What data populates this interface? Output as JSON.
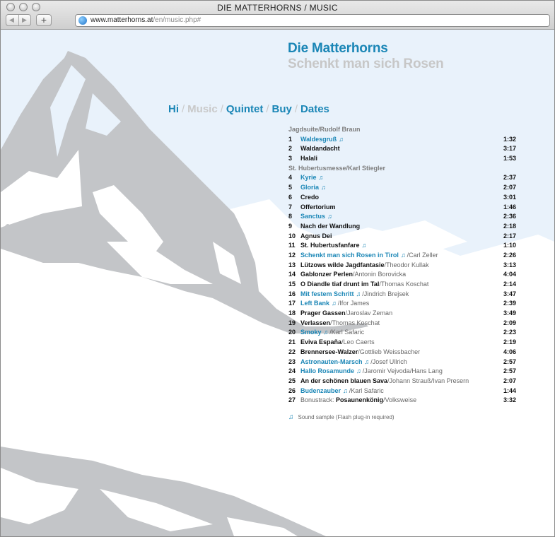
{
  "window": {
    "title": "DIE MATTERHORNS / MUSIC"
  },
  "browser": {
    "url_host": "www.matterhorns.at",
    "url_path": "/en/music.php#",
    "back_glyph": "◀",
    "forward_glyph": "▶",
    "new_tab_glyph": "+"
  },
  "header": {
    "title": "Die Matterhorns",
    "subtitle": "Schenkt man sich Rosen"
  },
  "nav": {
    "items": [
      {
        "label": "Hi"
      },
      {
        "label": "Music"
      },
      {
        "label": "Quintet"
      },
      {
        "label": "Buy"
      },
      {
        "label": "Dates"
      }
    ],
    "separator": "/"
  },
  "tracklist": {
    "note_glyph": "♫",
    "groups": [
      {
        "label": "Jagdsuite/Rudolf Braun"
      },
      {
        "label": "St. Hubertusmesse/Karl Stiegler"
      }
    ],
    "tracks": [
      {
        "n": "1",
        "title": "Waldesgruß",
        "composer": "",
        "duration": "1:32"
      },
      {
        "n": "2",
        "title": "Waldandacht",
        "composer": "",
        "duration": "3:17"
      },
      {
        "n": "3",
        "title": "Halali",
        "composer": "",
        "duration": "1:53"
      },
      {
        "n": "4",
        "title": "Kyrie",
        "composer": "",
        "duration": "2:37"
      },
      {
        "n": "5",
        "title": "Gloria",
        "composer": "",
        "duration": "2:07"
      },
      {
        "n": "6",
        "title": "Credo",
        "composer": "",
        "duration": "3:01"
      },
      {
        "n": "7",
        "title": "Offertorium",
        "composer": "",
        "duration": "1:46"
      },
      {
        "n": "8",
        "title": "Sanctus",
        "composer": "",
        "duration": "2:36"
      },
      {
        "n": "9",
        "title": "Nach der Wandlung",
        "composer": "",
        "duration": "2:18"
      },
      {
        "n": "10",
        "title": "Agnus Dei",
        "composer": "",
        "duration": "2:17"
      },
      {
        "n": "11",
        "title": "St. Hubertusfanfare",
        "composer": "",
        "duration": "1:10"
      },
      {
        "n": "12",
        "title": "Schenkt man sich Rosen in Tirol",
        "composer": "/Carl Zeller",
        "duration": "2:26"
      },
      {
        "n": "13",
        "title": "Lützows wilde Jagdfantasie",
        "composer": "/Theodor Kullak",
        "duration": "3:13"
      },
      {
        "n": "14",
        "title": "Gablonzer Perlen",
        "composer": "/Antonin Borovicka",
        "duration": "4:04"
      },
      {
        "n": "15",
        "title": "O Diandle tiaf drunt im Tal",
        "composer": "/Thomas Koschat",
        "duration": "2:14"
      },
      {
        "n": "16",
        "title": "Mit festem Schritt",
        "composer": "/Jindrich Brejsek",
        "duration": "3:47"
      },
      {
        "n": "17",
        "title": "Left Bank",
        "composer": "/Ifor James",
        "duration": "2:39"
      },
      {
        "n": "18",
        "title": "Prager Gassen",
        "composer": "/Jaroslav Zeman",
        "duration": "3:49"
      },
      {
        "n": "19",
        "title": "Verlassen",
        "composer": "/Thomas Koschat",
        "duration": "2:09"
      },
      {
        "n": "20",
        "title": "Smoky",
        "composer": "/Karl Safaric",
        "duration": "2:23"
      },
      {
        "n": "21",
        "title": "Eviva España",
        "composer": "/Leo Caerts",
        "duration": "2:19"
      },
      {
        "n": "22",
        "title": "Brennersee-Walzer",
        "composer": "/Gottlieb Weissbacher",
        "duration": "4:06"
      },
      {
        "n": "23",
        "title": "Astronauten-Marsch",
        "composer": "/Josef Ullrich",
        "duration": "2:57"
      },
      {
        "n": "24",
        "title": "Hallo Rosamunde",
        "composer": "/Jaromir Vejvoda/Hans Lang",
        "duration": "2:57"
      },
      {
        "n": "25",
        "title": "An der schönen blauen Sava",
        "composer": "/Johann Strauß/Ivan Presern",
        "duration": "2:07"
      },
      {
        "n": "26",
        "title": "Budenzauber",
        "composer": "/Karl Safaric",
        "duration": "1:44"
      },
      {
        "n": "27",
        "prefix": "Bonustrack: ",
        "title": "Posaunenkönig",
        "composer": "/Volksweise",
        "duration": "3:32"
      }
    ]
  },
  "footnote": {
    "text": "Sound sample (Flash plug-in required)"
  },
  "colors": {
    "accent": "#1a86b6",
    "muted": "#c9c9c9",
    "mountain": "#c3c5c8",
    "sky": "#e9f2fb"
  }
}
